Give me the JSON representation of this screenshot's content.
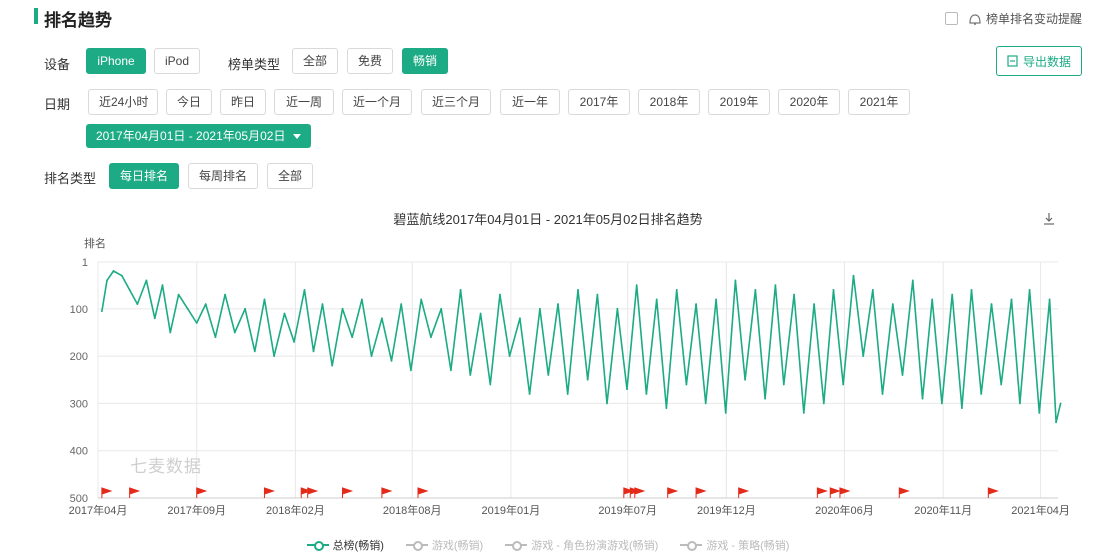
{
  "header": {
    "title": "排名趋势",
    "toggle_label": "榜单排名变动提醒"
  },
  "filters": {
    "device_label": "设备",
    "devices": [
      "iPhone",
      "iPod"
    ],
    "device_selected": "iPhone",
    "list_type_label": "榜单类型",
    "list_types": [
      "全部",
      "免费",
      "畅销"
    ],
    "list_type_selected": "畅销",
    "export_label": "导出数据",
    "date_label": "日期",
    "dates": [
      "近24小时",
      "今日",
      "昨日",
      "近一周",
      "近一个月",
      "近三个月",
      "近一年",
      "2017年",
      "2018年",
      "2019年",
      "2020年",
      "2021年"
    ],
    "date_range": "2017年04月01日 - 2021年05月02日",
    "rank_type_label": "排名类型",
    "rank_types": [
      "每日排名",
      "每周排名",
      "全部"
    ],
    "rank_type_selected": "每日排名"
  },
  "chart_data": {
    "type": "line",
    "title": "碧蓝航线2017年04月01日 - 2021年05月02日排名趋势",
    "ylabel": "排名",
    "y_reversed": true,
    "ylim": [
      1,
      500
    ],
    "yticks": [
      "1",
      "100",
      "200",
      "300",
      "400",
      "500"
    ],
    "x_ticklabels": [
      "2017年04月",
      "2017年09月",
      "2018年02月",
      "2018年08月",
      "2019年01月",
      "2019年07月",
      "2019年12月",
      "2020年06月",
      "2020年11月",
      "2021年04月"
    ],
    "x_tickdates": [
      "2017-04",
      "2017-09",
      "2018-02",
      "2018-08",
      "2019-01",
      "2019-07",
      "2019-12",
      "2020-06",
      "2020-11",
      "2021-04"
    ],
    "series": [
      {
        "name": "总榜(畅销)",
        "color": "#1cab84",
        "x": [
          "2017-04-07",
          "2017-04-15",
          "2017-04-25",
          "2017-05-08",
          "2017-05-20",
          "2017-06-01",
          "2017-06-15",
          "2017-06-28",
          "2017-07-10",
          "2017-07-22",
          "2017-08-04",
          "2017-08-18",
          "2017-09-01",
          "2017-09-15",
          "2017-09-30",
          "2017-10-15",
          "2017-10-30",
          "2017-11-15",
          "2017-11-30",
          "2017-12-15",
          "2017-12-30",
          "2018-01-15",
          "2018-01-30",
          "2018-02-15",
          "2018-03-01",
          "2018-03-15",
          "2018-03-30",
          "2018-04-15",
          "2018-04-30",
          "2018-05-15",
          "2018-05-30",
          "2018-06-15",
          "2018-06-30",
          "2018-07-15",
          "2018-07-30",
          "2018-08-15",
          "2018-08-30",
          "2018-09-15",
          "2018-09-30",
          "2018-10-15",
          "2018-10-30",
          "2018-11-15",
          "2018-11-30",
          "2018-12-15",
          "2018-12-30",
          "2019-01-15",
          "2019-01-30",
          "2019-02-15",
          "2019-02-28",
          "2019-03-15",
          "2019-03-30",
          "2019-04-15",
          "2019-04-30",
          "2019-05-15",
          "2019-05-30",
          "2019-06-15",
          "2019-06-30",
          "2019-07-15",
          "2019-07-30",
          "2019-08-15",
          "2019-08-30",
          "2019-09-15",
          "2019-09-30",
          "2019-10-15",
          "2019-10-30",
          "2019-11-15",
          "2019-11-30",
          "2019-12-15",
          "2019-12-30",
          "2020-01-15",
          "2020-01-30",
          "2020-02-15",
          "2020-02-28",
          "2020-03-15",
          "2020-03-30",
          "2020-04-15",
          "2020-04-30",
          "2020-05-15",
          "2020-05-30",
          "2020-06-15",
          "2020-06-30",
          "2020-07-15",
          "2020-07-30",
          "2020-08-15",
          "2020-08-30",
          "2020-09-15",
          "2020-09-30",
          "2020-10-15",
          "2020-10-30",
          "2020-11-15",
          "2020-11-30",
          "2020-12-15",
          "2020-12-30",
          "2021-01-15",
          "2021-01-30",
          "2021-02-15",
          "2021-02-28",
          "2021-03-15",
          "2021-03-30",
          "2021-04-15",
          "2021-04-25",
          "2021-05-02"
        ],
        "values": [
          105,
          40,
          20,
          30,
          60,
          90,
          40,
          120,
          50,
          150,
          70,
          100,
          130,
          90,
          160,
          70,
          150,
          100,
          190,
          80,
          200,
          110,
          170,
          60,
          190,
          90,
          220,
          100,
          160,
          80,
          200,
          120,
          210,
          90,
          230,
          80,
          160,
          100,
          230,
          60,
          240,
          110,
          260,
          70,
          200,
          120,
          280,
          100,
          240,
          90,
          280,
          60,
          250,
          70,
          300,
          100,
          270,
          50,
          280,
          80,
          310,
          60,
          260,
          90,
          300,
          80,
          320,
          40,
          250,
          60,
          290,
          50,
          260,
          70,
          320,
          90,
          300,
          60,
          260,
          30,
          200,
          60,
          280,
          90,
          240,
          40,
          290,
          80,
          300,
          70,
          310,
          60,
          280,
          90,
          260,
          80,
          300,
          60,
          320,
          80,
          340,
          300
        ]
      },
      {
        "name": "游戏(畅销)",
        "color": "#bbbbbb"
      },
      {
        "name": "游戏 - 角色扮演游戏(畅销)",
        "color": "#bbbbbb"
      },
      {
        "name": "游戏 - 策略(畅销)",
        "color": "#bbbbbb"
      }
    ],
    "version_flags": [
      "2017-04-07",
      "2017-05-20",
      "2017-09-01",
      "2017-12-15",
      "2018-02-10",
      "2018-02-20",
      "2018-04-15",
      "2018-06-15",
      "2018-08-10",
      "2019-06-25",
      "2019-07-05",
      "2019-07-12",
      "2019-09-01",
      "2019-10-15",
      "2019-12-20",
      "2020-04-20",
      "2020-05-10",
      "2020-05-25",
      "2020-08-25",
      "2021-01-10"
    ]
  },
  "watermark": "七麦数据"
}
